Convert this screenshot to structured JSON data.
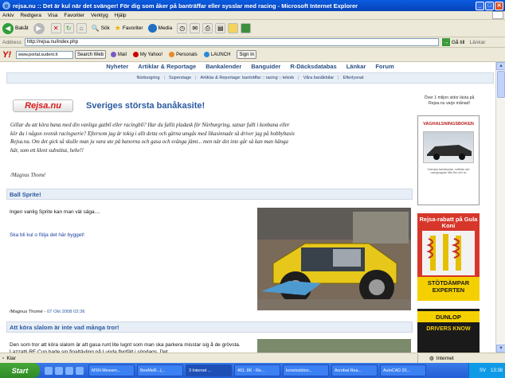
{
  "window": {
    "title": "rejsa.nu :: Det är kul när det svänger! För dig som åker på banträffar eller sysslar med racing - Microsoft Internet Explorer"
  },
  "menu": [
    "Arkiv",
    "Redigera",
    "Visa",
    "Favoriter",
    "Verktyg",
    "Hjälp"
  ],
  "toolbar": {
    "back": "Bakåt",
    "search": "Sök",
    "favorites": "Favoriter",
    "media": "Media"
  },
  "address": {
    "label": "Address",
    "url": "http://rejsa.nu/index.php",
    "go": "Gå till",
    "links": "Länkar"
  },
  "yahoo": {
    "input_value": "www.portal.sudent.lt",
    "search_web": "Search Web",
    "mail": "Mail",
    "my_yahoo": "My Yahoo!",
    "personals": "Personals",
    "launch": "LAUNCH",
    "sign_in": "Sign In"
  },
  "nav": {
    "main": [
      "Nyheter",
      "Artiklar & Reportage",
      "Bankalender",
      "Banguider",
      "R-Däcksdatabas",
      "Länkar",
      "Forum"
    ],
    "sub": [
      "Nürburgring",
      "Superstage",
      "Artiklar & Reportage: banträffar :: racing :: teknik",
      "Våra banåkbilar",
      "Efterlysnat"
    ]
  },
  "header": {
    "logo": "Rejsa.nu",
    "tagline": "Sveriges största banåkasite!"
  },
  "intro": {
    "text": "Gillar du att köra bana med din vanliga gatbil eller racingbil? Har du fallit pladask för Nürburgring, satsar fullt i konbana eller kör du i någon svensk racingserie? Eftersom jag är tokig i allt detta och gärna umgås med likasinnade så driver jag på hobbybasis Rejsa.nu. Om det gick så skulle man ju vara ute på banorna och gasa och svänga jämt... men när det inte går så kan man hänga här, som ett klent substitut, hehe!!",
    "signature": "/Magnus Thomé"
  },
  "articles": [
    {
      "title": "Ball Sprite!",
      "body": "Ingen vanlig Sprite kan man väl säga....",
      "link": "Ska bli kul o följa det här bygget!",
      "author": "/Magnus Thomé",
      "date": "07 Okt 2008 02:36"
    },
    {
      "title": "Att köra slalom är inte vad många tror!",
      "body": "Den som tror att köra slalom är att gasa runt lite lugnt som man ska parkera misstar sig å de grövsta. Lazzatti RE Cup hade sin finaltävling på Lunda flygfält i söndags. Det"
    }
  ],
  "sidebar": {
    "count_text": "Över 1 miljon sidor lästa på Rejsa.nu varje månad!",
    "ad_book_title": "VAGHALSNINGSBOKEN",
    "ad_book_fineprint": "Svenska fartvidunder, ruttbilar och racingvagnar från förr och nu",
    "ad_koni_title": "Rejsa-rabatt på Gula Koni",
    "ad_koni_band": "STÖTDÄMPAR EXPERTEN",
    "ad_dunlop": "DUNLOP",
    "ad_dunlop_sub": "DRIVERS KNOW"
  },
  "status": {
    "text": "Klar",
    "zone": "Internet"
  },
  "taskbar": {
    "start": "Start",
    "tasks": [
      "MSN Messen...",
      "BeeMeR...(...",
      "3 Internet ...",
      "401. 8K - Re...",
      "konstruktion...",
      "Acrobat Rea...",
      "AutoCAD 20..."
    ],
    "lang": "SV",
    "clock": "13:38"
  },
  "colors": {
    "accent": "#2a5aa0",
    "logo_red": "#d81a1a",
    "nav_bg": "#e8eef6"
  }
}
